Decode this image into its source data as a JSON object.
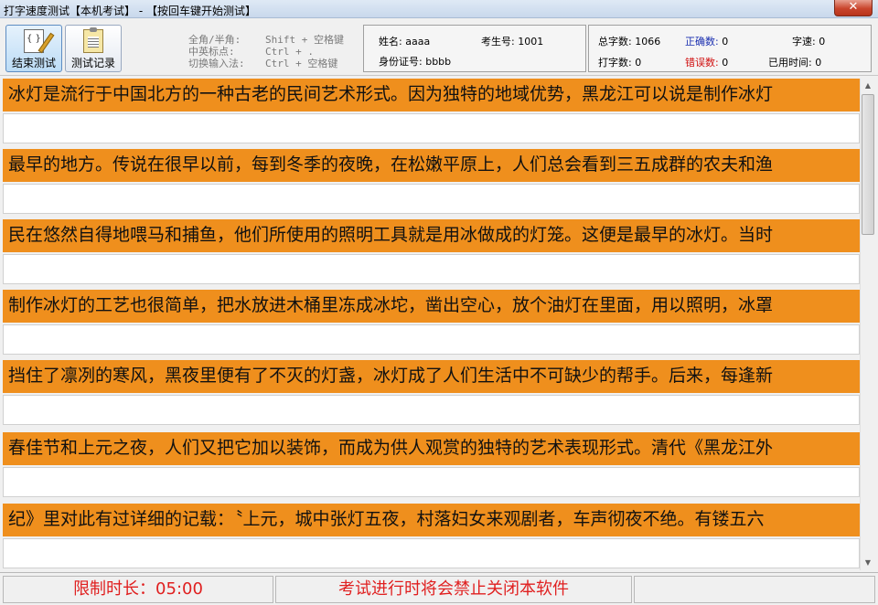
{
  "window": {
    "title": "打字速度测试【本机考试】 - 【按回车键开始测试】",
    "close_label": "✕"
  },
  "toolbar": {
    "end_test_label": "结束测试",
    "test_record_label": "测试记录"
  },
  "shortcuts": [
    {
      "name": "全角/半角:",
      "keys": "Shift + 空格键"
    },
    {
      "name": "中英标点:",
      "keys": "Ctrl + ."
    },
    {
      "name": "切换输入法:",
      "keys": "Ctrl + 空格键"
    }
  ],
  "user": {
    "name_label": "姓名:",
    "name_value": "aaaa",
    "exam_no_label": "考生号:",
    "exam_no_value": "1001",
    "id_label": "身份证号:",
    "id_value": "bbbb"
  },
  "stats": {
    "total_label": "总字数:",
    "total_value": "1066",
    "correct_label": "正确数:",
    "correct_value": "0",
    "speed_label": "字速:",
    "speed_value": "0",
    "typed_label": "打字数:",
    "typed_value": "0",
    "error_label": "错误数:",
    "error_value": "0",
    "elapsed_label": "已用时间:",
    "elapsed_value": "0"
  },
  "text_lines": [
    "冰灯是流行于中国北方的一种古老的民间艺术形式。因为独特的地域优势，黑龙江可以说是制作冰灯",
    "最早的地方。传说在很早以前，每到冬季的夜晚，在松嫩平原上，人们总会看到三五成群的农夫和渔",
    "民在悠然自得地喂马和捕鱼，他们所使用的照明工具就是用冰做成的灯笼。这便是最早的冰灯。当时",
    "制作冰灯的工艺也很简单，把水放进木桶里冻成冰坨，凿出空心，放个油灯在里面，用以照明，冰罩",
    "挡住了凛冽的寒风，黑夜里便有了不灭的灯盏，冰灯成了人们生活中不可缺少的帮手。后来，每逢新",
    "春佳节和上元之夜，人们又把它加以装饰，而成为供人观赏的独特的艺术表现形式。清代《黑龙江外",
    "纪》里对此有过详细的记载：〝上元，城中张灯五夜，村落妇女来观剧者，车声彻夜不绝。有镂五六"
  ],
  "status": {
    "time_limit": "限制时长：05:00",
    "warning": "考试进行时将会禁止关闭本软件"
  },
  "colors": {
    "original_line_bg": "#ef8f1d",
    "status_text": "#e02020",
    "correct_label": "#1a2fb0",
    "error_label": "#d01010"
  }
}
